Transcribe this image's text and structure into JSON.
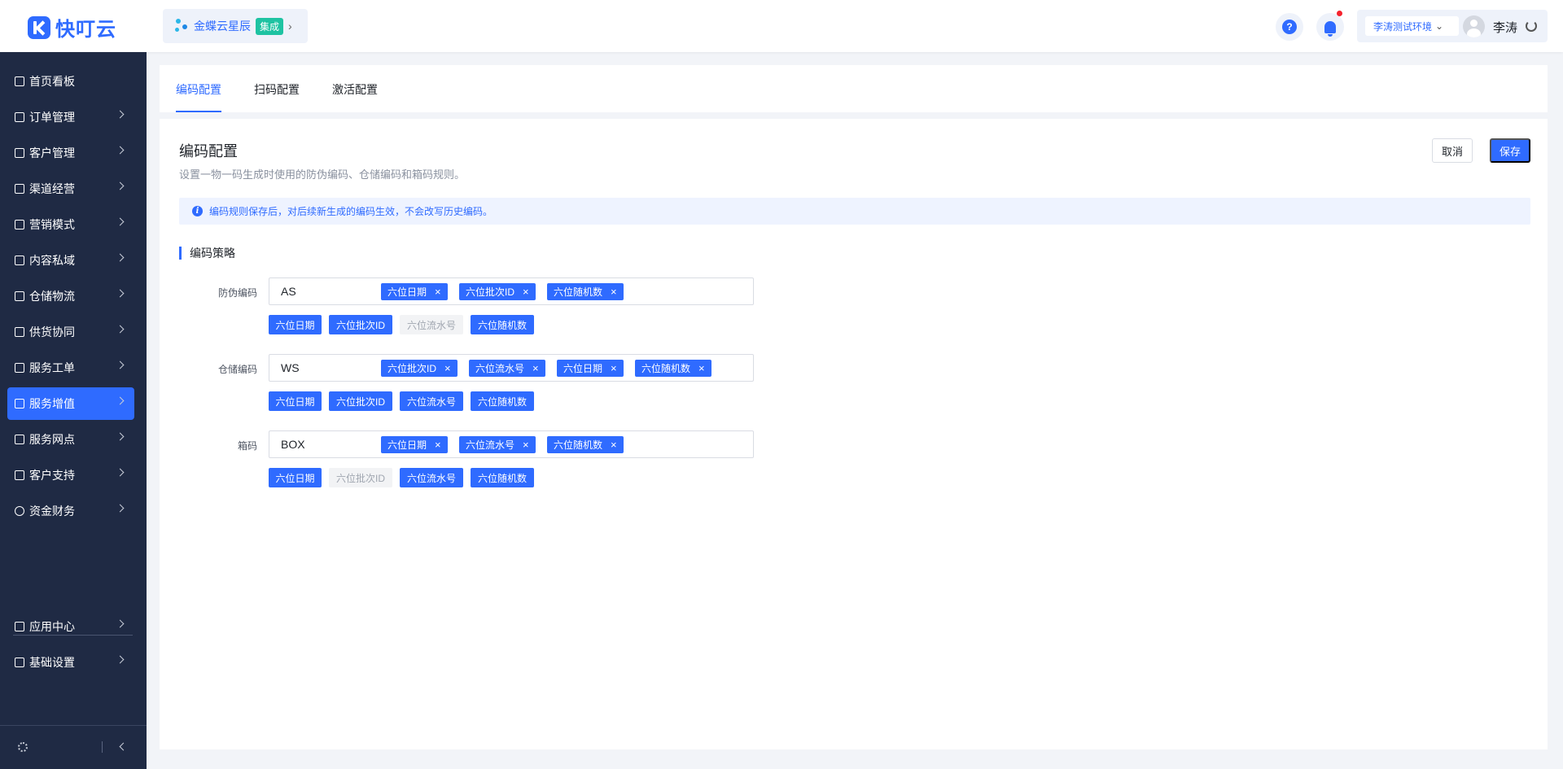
{
  "header": {
    "logo_text": "快叮云",
    "integration_name": "金蝶云星辰",
    "integration_badge": "集成",
    "help_label": "?",
    "environment": "李涛测试环境",
    "user_name": "李涛"
  },
  "sidebar": {
    "items": [
      {
        "label": "首页看板",
        "icon": "home-icon"
      },
      {
        "label": "订单管理",
        "icon": "order-icon"
      },
      {
        "label": "客户管理",
        "icon": "customer-icon"
      },
      {
        "label": "渠道经营",
        "icon": "channel-icon"
      },
      {
        "label": "营销模式",
        "icon": "tag-icon"
      },
      {
        "label": "内容私域",
        "icon": "image-icon"
      },
      {
        "label": "仓储物流",
        "icon": "warehouse-icon"
      },
      {
        "label": "供货协同",
        "icon": "supply-icon"
      },
      {
        "label": "服务工单",
        "icon": "ticket-icon"
      },
      {
        "label": "服务增值",
        "icon": "bag-icon"
      },
      {
        "label": "服务网点",
        "icon": "store-icon"
      },
      {
        "label": "客户支持",
        "icon": "support-icon"
      },
      {
        "label": "资金财务",
        "icon": "finance-icon"
      }
    ],
    "bottom_items": [
      {
        "label": "应用中心",
        "icon": "app-icon"
      },
      {
        "label": "基础设置",
        "icon": "settings-icon"
      }
    ],
    "active_label": "服务增值"
  },
  "tabs": [
    "编码配置",
    "扫码配置",
    "激活配置"
  ],
  "page": {
    "title": "编码配置",
    "description": "设置一物一码生成时使用的防伪编码、仓储编码和箱码规则。",
    "cancel_label": "取消",
    "save_label": "保存",
    "notice": "编码规则保存后，对后续新生成的编码生效，不会改写历史编码。",
    "notice_icon": "i",
    "section_title": "编码策略",
    "chip_remove": "×"
  },
  "rules": [
    {
      "label": "防伪编码",
      "prefix": "AS",
      "chips": [
        "六位日期",
        "六位批次ID",
        "六位随机数"
      ],
      "options": [
        {
          "label": "六位日期",
          "selected": true
        },
        {
          "label": "六位批次ID",
          "selected": true
        },
        {
          "label": "六位流水号",
          "selected": false
        },
        {
          "label": "六位随机数",
          "selected": true
        }
      ]
    },
    {
      "label": "仓储编码",
      "prefix": "WS",
      "chips": [
        "六位批次ID",
        "六位流水号",
        "六位日期",
        "六位随机数"
      ],
      "options": [
        {
          "label": "六位日期",
          "selected": true
        },
        {
          "label": "六位批次ID",
          "selected": true
        },
        {
          "label": "六位流水号",
          "selected": true
        },
        {
          "label": "六位随机数",
          "selected": true
        }
      ]
    },
    {
      "label": "箱码",
      "prefix": "BOX",
      "chips": [
        "六位日期",
        "六位流水号",
        "六位随机数"
      ],
      "options": [
        {
          "label": "六位日期",
          "selected": true
        },
        {
          "label": "六位批次ID",
          "selected": false
        },
        {
          "label": "六位流水号",
          "selected": true
        },
        {
          "label": "六位随机数",
          "selected": true
        }
      ]
    }
  ],
  "colors": {
    "primary": "#2f6bff",
    "sidebar_bg": "#1f2a44",
    "badge": "#1ec3a2"
  }
}
